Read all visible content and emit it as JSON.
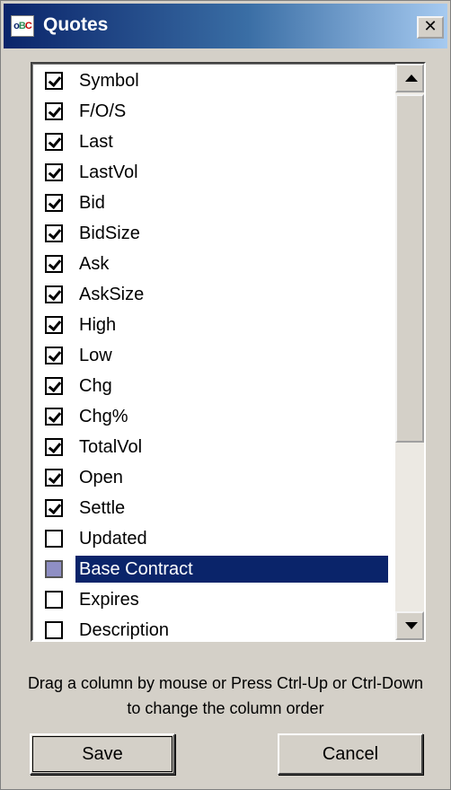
{
  "window": {
    "title": "Quotes",
    "close_glyph": "✕"
  },
  "app_icon": {
    "name": "quotes-app-icon",
    "glyph_g": "B",
    "glyph_r": "C",
    "glyph_b": "o"
  },
  "columns": [
    {
      "label": "Symbol",
      "state": "checked"
    },
    {
      "label": "F/O/S",
      "state": "checked"
    },
    {
      "label": "Last",
      "state": "checked"
    },
    {
      "label": "LastVol",
      "state": "checked"
    },
    {
      "label": "Bid",
      "state": "checked"
    },
    {
      "label": "BidSize",
      "state": "checked"
    },
    {
      "label": "Ask",
      "state": "checked"
    },
    {
      "label": "AskSize",
      "state": "checked"
    },
    {
      "label": "High",
      "state": "checked"
    },
    {
      "label": "Low",
      "state": "checked"
    },
    {
      "label": "Chg",
      "state": "checked"
    },
    {
      "label": "Chg%",
      "state": "checked"
    },
    {
      "label": "TotalVol",
      "state": "checked"
    },
    {
      "label": "Open",
      "state": "checked"
    },
    {
      "label": "Settle",
      "state": "checked"
    },
    {
      "label": "Updated",
      "state": "unchecked"
    },
    {
      "label": "Base Contract",
      "state": "indeterminate",
      "selected": true
    },
    {
      "label": "Expires",
      "state": "unchecked"
    },
    {
      "label": "Description",
      "state": "unchecked"
    }
  ],
  "help_text": "Drag a column by mouse or Press Ctrl-Up or Ctrl-Down to change the column order",
  "buttons": {
    "save": "Save",
    "cancel": "Cancel"
  },
  "colors": {
    "title_start": "#0a246a",
    "title_end": "#a6caf0",
    "selection": "#0a246a",
    "face": "#d4d0c8"
  }
}
